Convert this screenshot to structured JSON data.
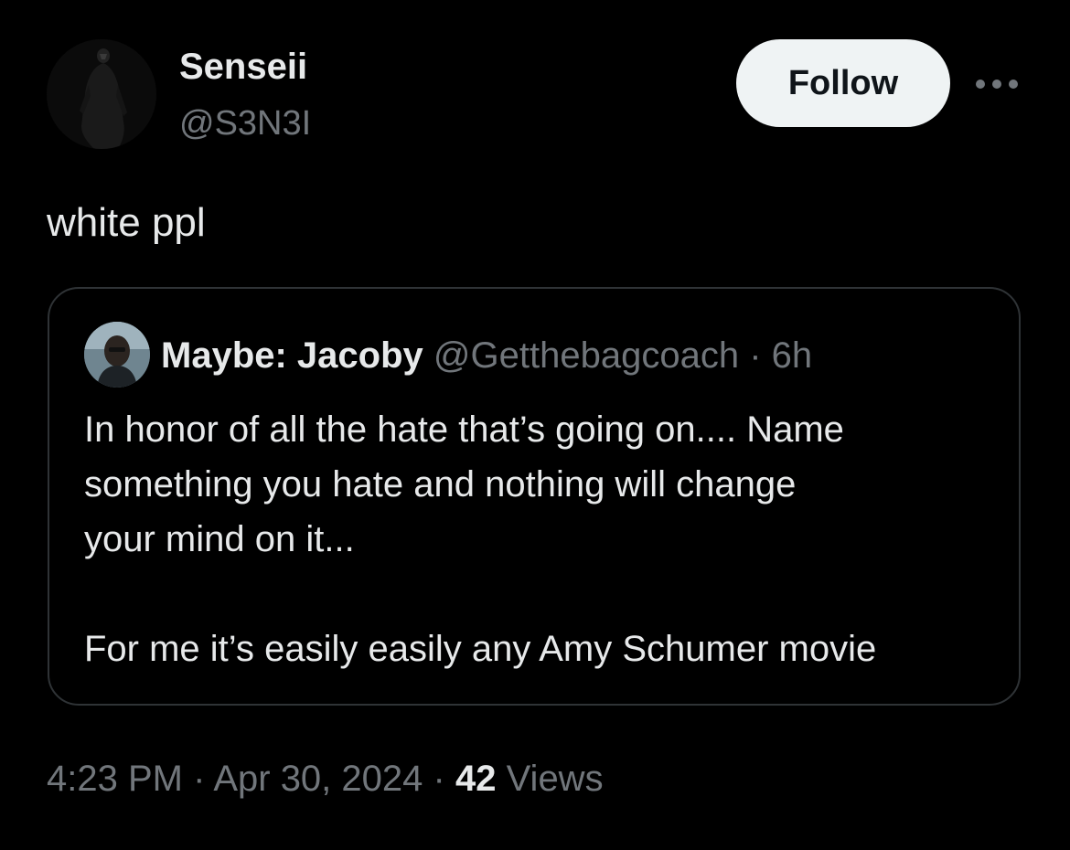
{
  "author": {
    "display_name": "Senseii",
    "handle": "@S3N3I",
    "avatar_icon": "hooded-figure-avatar"
  },
  "actions": {
    "follow_label": "Follow",
    "more_icon": "more-dots-icon"
  },
  "tweet": {
    "text": "white ppl"
  },
  "quoted": {
    "display_name": "Maybe: Jacoby",
    "handle": "@Getthebagcoach",
    "separator": "·",
    "time": "6h",
    "body_lines": [
      "In honor of all the hate that’s going on.... Name",
      "something you hate and nothing will change",
      "your mind on it...",
      "",
      "For me it’s easily easily any Amy Schumer movie"
    ]
  },
  "meta": {
    "time": "4:23 PM",
    "sep1": "·",
    "date": "Apr 30, 2024",
    "sep2": "·",
    "views_count": "42",
    "views_label": "Views"
  },
  "colors": {
    "background": "#000000",
    "primary_text": "#e7e9ea",
    "secondary_text": "#71767b",
    "border": "#2f3336",
    "follow_bg": "#eff3f4",
    "follow_text": "#0f1419"
  }
}
